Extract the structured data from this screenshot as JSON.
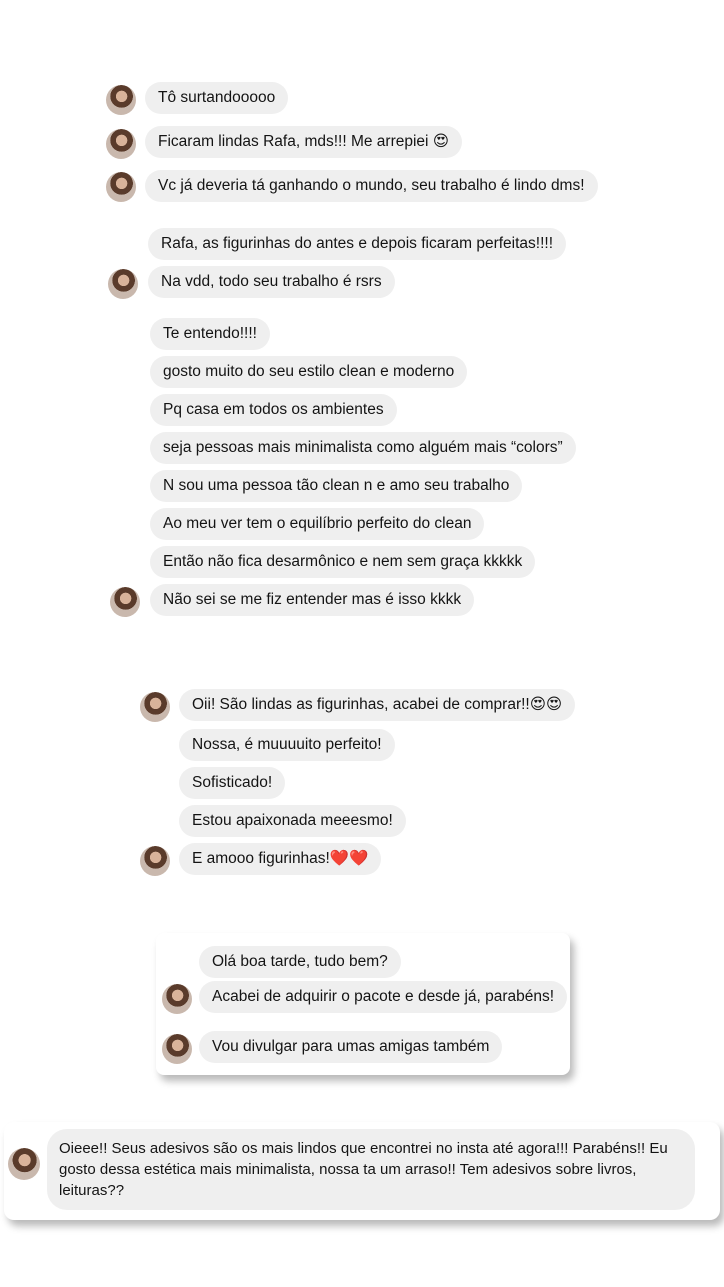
{
  "group1": {
    "messages": [
      "Tô surtandooooo",
      "Ficaram lindas Rafa, mds!!! Me arrepiei 😍",
      "Vc já deveria tá ganhando o mundo, seu trabalho é lindo dms!"
    ]
  },
  "group2": {
    "messages": [
      "Rafa, as figurinhas do antes e depois ficaram perfeitas!!!!",
      "Na vdd, todo seu trabalho é rsrs"
    ]
  },
  "group3": {
    "messages": [
      "Te entendo!!!!",
      "gosto muito do seu estilo clean e moderno",
      "Pq casa em todos os ambientes",
      "seja pessoas mais minimalista como alguém mais “colors”",
      "N sou uma pessoa tão clean n e amo seu trabalho",
      "Ao meu ver tem o equilíbrio perfeito do clean",
      "Então não fica desarmônico e nem sem graça kkkkk",
      "Não sei se me fiz entender mas é isso kkkk"
    ]
  },
  "group4": {
    "messages": [
      "Oii! São lindas as figurinhas, acabei de comprar!!😍😍",
      "Nossa, é muuuuito perfeito!",
      "Sofisticado!",
      "Estou apaixonada meeesmo!",
      "E amooo figurinhas!❤️❤️"
    ]
  },
  "group5": {
    "messages": [
      "Olá boa tarde, tudo bem?",
      "Acabei de adquirir o pacote e desde já, parabéns!",
      "Vou divulgar para umas amigas também"
    ]
  },
  "group6": {
    "message": "Oieee!! Seus adesivos são os mais lindos que encontrei no insta até agora!!! Parabéns!! Eu gosto dessa estética mais minimalista, nossa ta um arraso!! Tem adesivos sobre livros, leituras??"
  },
  "colors": {
    "bubble": "#efefef",
    "background": "#ffffff"
  }
}
